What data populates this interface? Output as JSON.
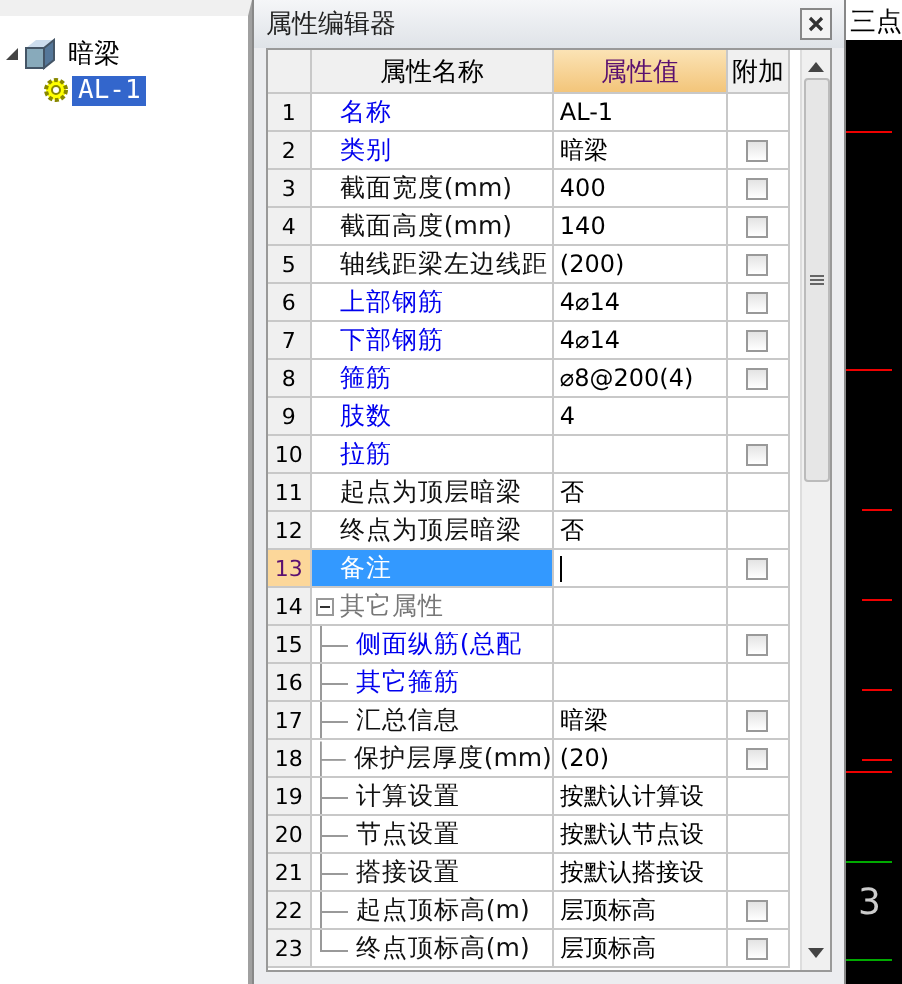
{
  "tree": [
    {
      "label": "暗梁",
      "expanded": true,
      "children": [
        {
          "label": "AL-1",
          "selected": true
        }
      ]
    }
  ],
  "dialog": {
    "title": "属性编辑器"
  },
  "columns": [
    "属性名称",
    "属性值",
    "附加"
  ],
  "rows": [
    {
      "number": "1",
      "name": "名称",
      "value": "AL-1",
      "kind": "public",
      "has_checkbox": false,
      "selected": false
    },
    {
      "number": "2",
      "name": "类别",
      "value": "暗梁",
      "kind": "public",
      "has_checkbox": true,
      "checked": false,
      "selected": false
    },
    {
      "number": "3",
      "name": "截面宽度(mm)",
      "value": "400",
      "kind": "private",
      "has_checkbox": true,
      "checked": false,
      "selected": false
    },
    {
      "number": "4",
      "name": "截面高度(mm)",
      "value": "140",
      "kind": "private",
      "has_checkbox": true,
      "checked": false,
      "selected": false
    },
    {
      "number": "5",
      "name": "轴线距梁左边线距",
      "value": "(200)",
      "kind": "private",
      "has_checkbox": true,
      "checked": false,
      "selected": false
    },
    {
      "number": "6",
      "name": "上部钢筋",
      "value": "4⌀14",
      "kind": "public",
      "has_checkbox": true,
      "checked": false,
      "selected": false
    },
    {
      "number": "7",
      "name": "下部钢筋",
      "value": "4⌀14",
      "kind": "public",
      "has_checkbox": true,
      "checked": false,
      "selected": false
    },
    {
      "number": "8",
      "name": "箍筋",
      "value": "⌀8@200(4)",
      "kind": "public",
      "has_checkbox": true,
      "checked": false,
      "selected": false
    },
    {
      "number": "9",
      "name": "肢数",
      "value": "4",
      "kind": "public",
      "has_checkbox": false,
      "selected": false
    },
    {
      "number": "10",
      "name": "拉筋",
      "kind": "public",
      "has_checkbox": true,
      "checked": false,
      "selected": false
    },
    {
      "number": "11",
      "name": "起点为顶层暗梁",
      "value": "否",
      "kind": "private",
      "has_checkbox": false,
      "selected": false
    },
    {
      "number": "12",
      "name": "终点为顶层暗梁",
      "value": "否",
      "kind": "private",
      "has_checkbox": false,
      "selected": false
    },
    {
      "number": "13",
      "name": "备注",
      "kind": "public",
      "has_checkbox": true,
      "checked": false,
      "selected": true
    },
    {
      "number": "14",
      "name": "其它属性",
      "kind": "group",
      "expanded": true,
      "has_checkbox": false,
      "selected": false,
      "children": [
        {
          "number": "15",
          "name": "侧面纵筋(总配",
          "kind": "public",
          "has_checkbox": true,
          "checked": false,
          "selected": false
        },
        {
          "number": "16",
          "name": "其它箍筋",
          "kind": "public",
          "has_checkbox": false,
          "selected": false
        },
        {
          "number": "17",
          "name": "汇总信息",
          "value": "暗梁",
          "kind": "private",
          "has_checkbox": true,
          "checked": false,
          "selected": false
        },
        {
          "number": "18",
          "name": "保护层厚度(mm)",
          "value": "(20)",
          "kind": "private",
          "has_checkbox": true,
          "checked": false,
          "selected": false
        },
        {
          "number": "19",
          "name": "计算设置",
          "value": "按默认计算设",
          "kind": "private",
          "has_checkbox": false,
          "selected": false
        },
        {
          "number": "20",
          "name": "节点设置",
          "value": "按默认节点设",
          "kind": "private",
          "has_checkbox": false,
          "selected": false
        },
        {
          "number": "21",
          "name": "搭接设置",
          "value": "按默认搭接设",
          "kind": "private",
          "has_checkbox": false,
          "selected": false
        },
        {
          "number": "22",
          "name": "起点顶标高(m)",
          "value": "层顶标高",
          "kind": "private",
          "has_checkbox": true,
          "checked": false,
          "selected": false
        },
        {
          "number": "23",
          "name": "终点顶标高(m)",
          "value": "层顶标高",
          "kind": "private",
          "has_checkbox": true,
          "checked": false,
          "selected": false
        }
      ]
    }
  ],
  "canvas": {
    "top_label": "三点",
    "bottom_label": "3"
  }
}
